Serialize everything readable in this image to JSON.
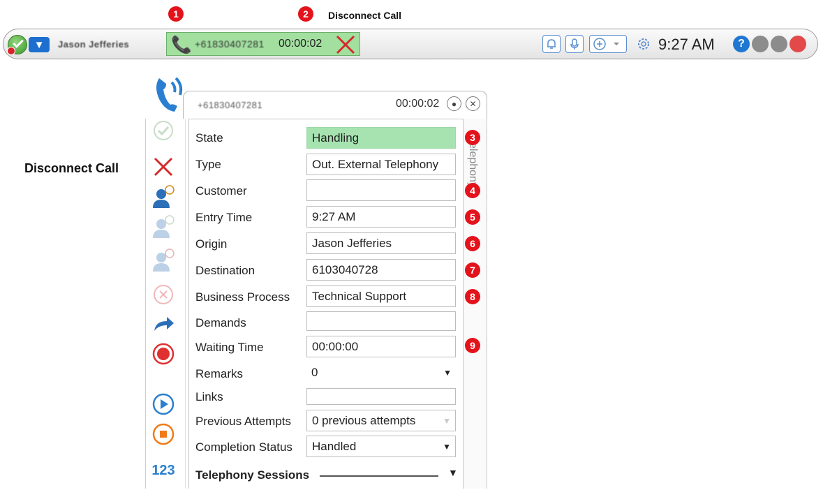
{
  "callouts": {
    "disconnect_top": "Disconnect Call",
    "disconnect_side": "Disconnect Call",
    "badges": [
      "1",
      "2",
      "3",
      "4",
      "5",
      "6",
      "7",
      "8",
      "9"
    ]
  },
  "toolbar": {
    "agent_name": "Jason Jefferies",
    "call_number": "+61830407281",
    "call_timer": "00:00:02",
    "clock": "9:27 AM",
    "help_label": "?",
    "icons": [
      "bell-icon",
      "microphone-icon",
      "add-circle-icon",
      "gear-icon"
    ]
  },
  "panel": {
    "number": "+61830407281",
    "timer": "00:00:02",
    "side_tab": "Telephony",
    "fields": {
      "state": {
        "label": "State",
        "value": "Handling"
      },
      "type": {
        "label": "Type",
        "value": "Out. External Telephony"
      },
      "customer": {
        "label": "Customer",
        "value": ""
      },
      "entry_time": {
        "label": "Entry Time",
        "value": "9:27 AM"
      },
      "origin": {
        "label": "Origin",
        "value": "Jason Jefferies"
      },
      "destination": {
        "label": "Destination",
        "value": "6103040728"
      },
      "business_process": {
        "label": "Business Process",
        "value": "Technical Support"
      },
      "demands": {
        "label": "Demands",
        "value": ""
      },
      "waiting_time": {
        "label": "Waiting Time",
        "value": "00:00:00"
      },
      "remarks": {
        "label": "Remarks",
        "value": "0"
      },
      "links": {
        "label": "Links",
        "value": ""
      },
      "previous_attempts": {
        "label": "Previous Attempts",
        "value": "0 previous attempts"
      },
      "completion_status": {
        "label": "Completion Status",
        "value": "Handled"
      }
    },
    "section_title": "Telephony Sessions",
    "side_icons_label": "123"
  },
  "colors": {
    "handling_green": "#a6e3b0",
    "call_green": "#a3e0a0",
    "badge_red": "#e3121b",
    "accent_blue": "#1d6fcf"
  }
}
